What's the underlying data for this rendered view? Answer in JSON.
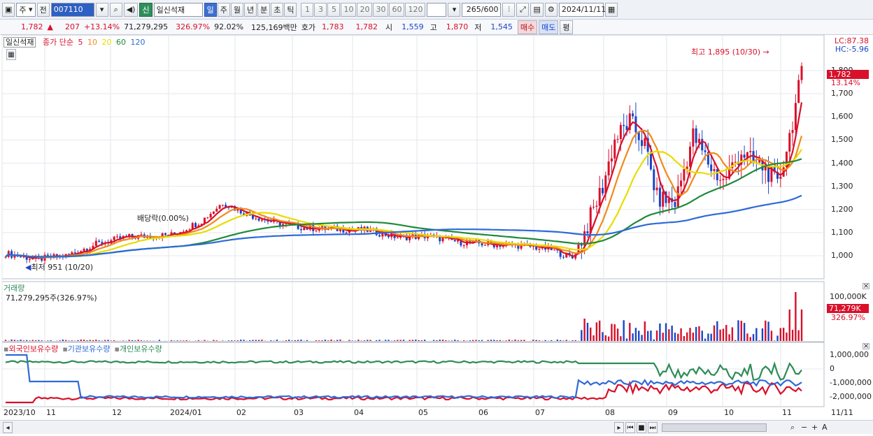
{
  "toolbar": {
    "type_select": "주",
    "prev_label": "전",
    "code": "007110",
    "badge": "신",
    "name": "일신석재",
    "periods": [
      "일",
      "주",
      "월",
      "년",
      "분",
      "초",
      "틱"
    ],
    "active_period": "일",
    "minute_steps": [
      "1",
      "3",
      "5",
      "10",
      "20",
      "30",
      "60",
      "120"
    ],
    "count": "265",
    "count_total": "/600",
    "date": "2024/11/11"
  },
  "quote": {
    "price": "1,782",
    "change_arrow": "▲",
    "change": "207",
    "change_pct": "+13.14%",
    "volume": "71,279,295",
    "vol_ratio": "326.97%",
    "pct2": "92.02%",
    "amount": "125,169백만",
    "hoga_label": "호가",
    "ask": "1,783",
    "bid": "1,782",
    "open_label": "시",
    "open": "1,559",
    "high_label": "고",
    "high": "1,870",
    "low_label": "저",
    "low": "1,545",
    "buy_btn": "매수",
    "sell_btn": "매도",
    "flat_btn": "평"
  },
  "price_panel": {
    "title": "일신석재",
    "ma_label": "종가 단순",
    "ma_periods": [
      {
        "label": "5",
        "color": "#d8102a"
      },
      {
        "label": "10",
        "color": "#f08a1c"
      },
      {
        "label": "20",
        "color": "#e8dc00"
      },
      {
        "label": "60",
        "color": "#1f8a3a"
      },
      {
        "label": "120",
        "color": "#2d6ad8"
      }
    ],
    "lc": "LC:87.38",
    "hc": "HC:-5.96",
    "high_note": "최고 1,895 (10/30)",
    "low_note": "최저 951 (10/20)",
    "dividend_note": "배당락(0.00%)",
    "cur_price": "1,782",
    "cur_pct": "13.14%",
    "y_ticks": [
      "1,800",
      "1,700",
      "1,600",
      "1,500",
      "1,400",
      "1,300",
      "1,200",
      "1,100",
      "1,000"
    ]
  },
  "volume_panel": {
    "title": "거래량",
    "value": "71,279,295주(326.97%)",
    "y_tick": "100,000K",
    "cur": "71,279K",
    "cur_pct": "326.97%"
  },
  "holding_panel": {
    "legends": [
      {
        "label": "외국인보유수량",
        "color": "#d8102a"
      },
      {
        "label": "기관보유수량",
        "color": "#2d6ad8"
      },
      {
        "label": "개인보유수량",
        "color": "#2e8b57"
      }
    ],
    "y_ticks": [
      "1,000,000",
      "0",
      "-1,000,000",
      "-2,000,000"
    ]
  },
  "x_axis": [
    "2023/10",
    "11",
    "12",
    "2024/01",
    "02",
    "03",
    "04",
    "05",
    "06",
    "07",
    "08",
    "09",
    "10",
    "11"
  ],
  "x_axis_right": "11/11",
  "colors": {
    "up": "#d8102a",
    "down": "#1a45c8"
  }
}
